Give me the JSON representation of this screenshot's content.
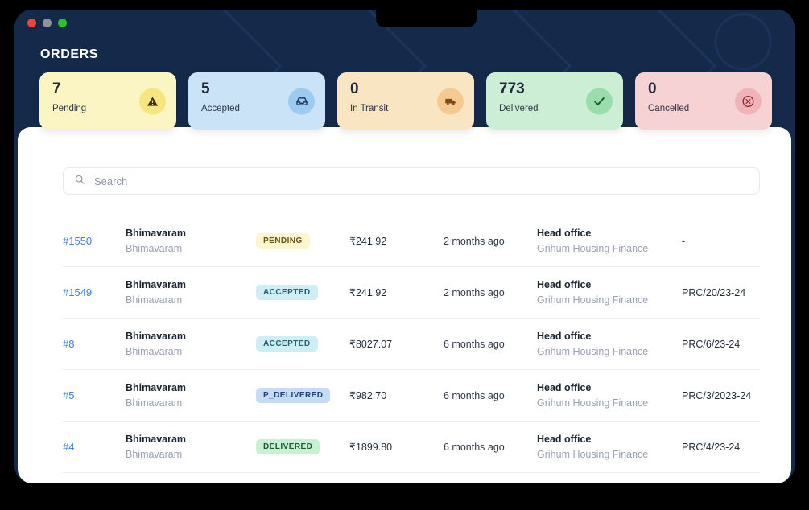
{
  "window": {
    "title": "ORDERS",
    "traffic_lights": [
      "close",
      "minimize",
      "maximize"
    ]
  },
  "stats": [
    {
      "value": "7",
      "label": "Pending",
      "icon": "warning-triangle-icon"
    },
    {
      "value": "5",
      "label": "Accepted",
      "icon": "inbox-icon"
    },
    {
      "value": "0",
      "label": "In Transit",
      "icon": "truck-icon"
    },
    {
      "value": "773",
      "label": "Delivered",
      "icon": "check-icon"
    },
    {
      "value": "0",
      "label": "Cancelled",
      "icon": "x-circle-icon"
    }
  ],
  "search": {
    "placeholder": "Search",
    "value": "",
    "icon": "search-icon"
  },
  "orders": [
    {
      "id": "#1550",
      "party": "Bhimavaram",
      "party_sub": "Bhimavaram",
      "status": "PENDING",
      "amount": "₹241.92",
      "time": "2 months ago",
      "office": "Head office",
      "office_sub": "Grihum Housing Finance",
      "reference": "-"
    },
    {
      "id": "#1549",
      "party": "Bhimavaram",
      "party_sub": "Bhimavaram",
      "status": "ACCEPTED",
      "amount": "₹241.92",
      "time": "2 months ago",
      "office": "Head office",
      "office_sub": "Grihum Housing Finance",
      "reference": "PRC/20/23-24"
    },
    {
      "id": "#8",
      "party": "Bhimavaram",
      "party_sub": "Bhimavaram",
      "status": "ACCEPTED",
      "amount": "₹8027.07",
      "time": "6 months ago",
      "office": "Head office",
      "office_sub": "Grihum Housing Finance",
      "reference": "PRC/6/23-24"
    },
    {
      "id": "#5",
      "party": "Bhimavaram",
      "party_sub": "Bhimavaram",
      "status": "P_DELIVERED",
      "amount": "₹982.70",
      "time": "6 months ago",
      "office": "Head office",
      "office_sub": "Grihum Housing Finance",
      "reference": "PRC/3/2023-24"
    },
    {
      "id": "#4",
      "party": "Bhimavaram",
      "party_sub": "Bhimavaram",
      "status": "DELIVERED",
      "amount": "₹1899.80",
      "time": "6 months ago",
      "office": "Head office",
      "office_sub": "Grihum Housing Finance",
      "reference": "PRC/4/23-24"
    }
  ],
  "colors": {
    "header_bg": "#15294b",
    "link": "#3e7fd6",
    "pending": "#fbf5c4",
    "accepted": "#cae3f7",
    "in_transit": "#fae5c3",
    "delivered": "#cbeed5",
    "cancelled": "#f6d2d4"
  }
}
